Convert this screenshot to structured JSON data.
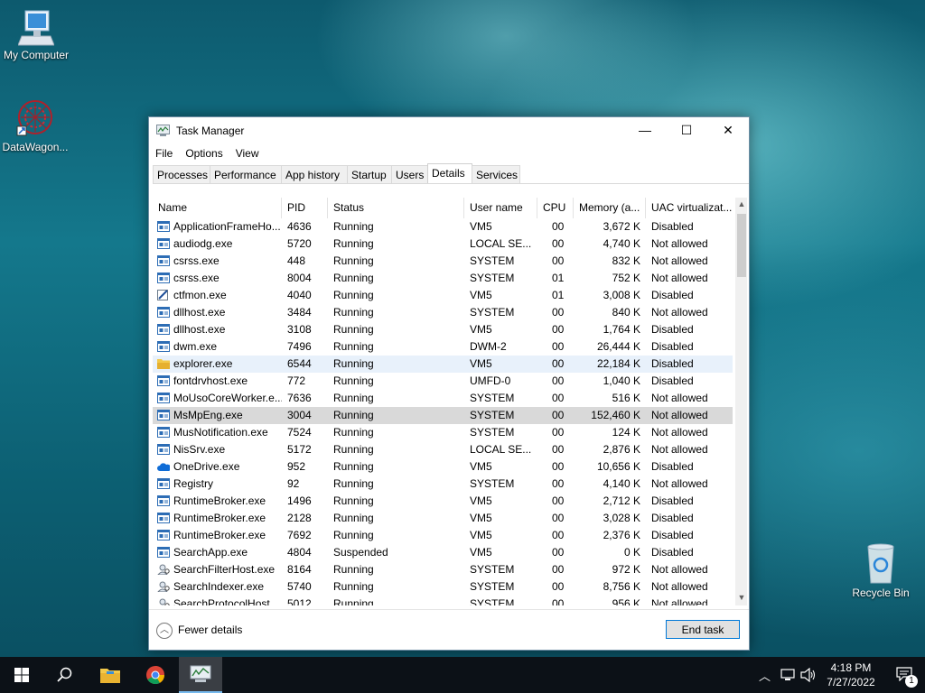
{
  "desktop": {
    "icons": [
      {
        "label": "My Computer"
      },
      {
        "label": "DataWagon..."
      },
      {
        "label": "Recycle Bin"
      }
    ]
  },
  "window": {
    "title": "Task Manager",
    "controls": {
      "minimize": "—",
      "maximize": "☐",
      "close": "✕"
    },
    "menu": [
      "File",
      "Options",
      "View"
    ],
    "tabs": [
      "Processes",
      "Performance",
      "App history",
      "Startup",
      "Users",
      "Details",
      "Services"
    ],
    "active_tab": "Details",
    "columns": [
      "Name",
      "PID",
      "Status",
      "User name",
      "CPU",
      "Memory (a...",
      "UAC virtualizat..."
    ],
    "sort_indicator": "^",
    "rows": [
      {
        "name": "ApplicationFrameHo...",
        "pid": "4636",
        "status": "Running",
        "user": "VM5",
        "cpu": "00",
        "mem": "3,672 K",
        "uac": "Disabled",
        "icon": "app-window-icon"
      },
      {
        "name": "audiodg.exe",
        "pid": "5720",
        "status": "Running",
        "user": "LOCAL SE...",
        "cpu": "00",
        "mem": "4,740 K",
        "uac": "Not allowed",
        "icon": "app-window-icon"
      },
      {
        "name": "csrss.exe",
        "pid": "448",
        "status": "Running",
        "user": "SYSTEM",
        "cpu": "00",
        "mem": "832 K",
        "uac": "Not allowed",
        "icon": "app-window-icon"
      },
      {
        "name": "csrss.exe",
        "pid": "8004",
        "status": "Running",
        "user": "SYSTEM",
        "cpu": "01",
        "mem": "752 K",
        "uac": "Not allowed",
        "icon": "app-window-icon"
      },
      {
        "name": "ctfmon.exe",
        "pid": "4040",
        "status": "Running",
        "user": "VM5",
        "cpu": "01",
        "mem": "3,008 K",
        "uac": "Disabled",
        "icon": "pen-icon"
      },
      {
        "name": "dllhost.exe",
        "pid": "3484",
        "status": "Running",
        "user": "SYSTEM",
        "cpu": "00",
        "mem": "840 K",
        "uac": "Not allowed",
        "icon": "app-window-icon"
      },
      {
        "name": "dllhost.exe",
        "pid": "3108",
        "status": "Running",
        "user": "VM5",
        "cpu": "00",
        "mem": "1,764 K",
        "uac": "Disabled",
        "icon": "app-window-icon"
      },
      {
        "name": "dwm.exe",
        "pid": "7496",
        "status": "Running",
        "user": "DWM-2",
        "cpu": "00",
        "mem": "26,444 K",
        "uac": "Disabled",
        "icon": "app-window-icon"
      },
      {
        "name": "explorer.exe",
        "pid": "6544",
        "status": "Running",
        "user": "VM5",
        "cpu": "00",
        "mem": "22,184 K",
        "uac": "Disabled",
        "icon": "folder-icon"
      },
      {
        "name": "fontdrvhost.exe",
        "pid": "772",
        "status": "Running",
        "user": "UMFD-0",
        "cpu": "00",
        "mem": "1,040 K",
        "uac": "Disabled",
        "icon": "app-window-icon"
      },
      {
        "name": "MoUsoCoreWorker.e...",
        "pid": "7636",
        "status": "Running",
        "user": "SYSTEM",
        "cpu": "00",
        "mem": "516 K",
        "uac": "Not allowed",
        "icon": "app-window-icon"
      },
      {
        "name": "MsMpEng.exe",
        "pid": "3004",
        "status": "Running",
        "user": "SYSTEM",
        "cpu": "00",
        "mem": "152,460 K",
        "uac": "Not allowed",
        "icon": "app-window-icon"
      },
      {
        "name": "MusNotification.exe",
        "pid": "7524",
        "status": "Running",
        "user": "SYSTEM",
        "cpu": "00",
        "mem": "124 K",
        "uac": "Not allowed",
        "icon": "app-window-icon"
      },
      {
        "name": "NisSrv.exe",
        "pid": "5172",
        "status": "Running",
        "user": "LOCAL SE...",
        "cpu": "00",
        "mem": "2,876 K",
        "uac": "Not allowed",
        "icon": "app-window-icon"
      },
      {
        "name": "OneDrive.exe",
        "pid": "952",
        "status": "Running",
        "user": "VM5",
        "cpu": "00",
        "mem": "10,656 K",
        "uac": "Disabled",
        "icon": "cloud-icon"
      },
      {
        "name": "Registry",
        "pid": "92",
        "status": "Running",
        "user": "SYSTEM",
        "cpu": "00",
        "mem": "4,140 K",
        "uac": "Not allowed",
        "icon": "app-window-icon"
      },
      {
        "name": "RuntimeBroker.exe",
        "pid": "1496",
        "status": "Running",
        "user": "VM5",
        "cpu": "00",
        "mem": "2,712 K",
        "uac": "Disabled",
        "icon": "app-window-icon"
      },
      {
        "name": "RuntimeBroker.exe",
        "pid": "2128",
        "status": "Running",
        "user": "VM5",
        "cpu": "00",
        "mem": "3,028 K",
        "uac": "Disabled",
        "icon": "app-window-icon"
      },
      {
        "name": "RuntimeBroker.exe",
        "pid": "7692",
        "status": "Running",
        "user": "VM5",
        "cpu": "00",
        "mem": "2,376 K",
        "uac": "Disabled",
        "icon": "app-window-icon"
      },
      {
        "name": "SearchApp.exe",
        "pid": "4804",
        "status": "Suspended",
        "user": "VM5",
        "cpu": "00",
        "mem": "0 K",
        "uac": "Disabled",
        "icon": "app-window-icon"
      },
      {
        "name": "SearchFilterHost.exe",
        "pid": "8164",
        "status": "Running",
        "user": "SYSTEM",
        "cpu": "00",
        "mem": "972 K",
        "uac": "Not allowed",
        "icon": "search-user-icon"
      },
      {
        "name": "SearchIndexer.exe",
        "pid": "5740",
        "status": "Running",
        "user": "SYSTEM",
        "cpu": "00",
        "mem": "8,756 K",
        "uac": "Not allowed",
        "icon": "search-user-icon"
      },
      {
        "name": "SearchProtocolHost...",
        "pid": "5012",
        "status": "Running",
        "user": "SYSTEM",
        "cpu": "00",
        "mem": "956 K",
        "uac": "Not allowed",
        "icon": "search-user-icon"
      }
    ],
    "footer": {
      "fewer_details": "Fewer details",
      "end_task": "End task"
    }
  },
  "taskbar": {
    "apps": [
      "start-icon",
      "search-icon",
      "file-explorer-icon",
      "chrome-icon",
      "task-manager-icon"
    ],
    "clock": {
      "time": "4:18 PM",
      "date": "7/27/2022"
    },
    "notification_count": "1"
  },
  "colors": {
    "accent": "#0078d7",
    "row_hover": "#e8f1fb",
    "row_selected": "#d9d9d9",
    "taskbar": "#0c1117"
  }
}
